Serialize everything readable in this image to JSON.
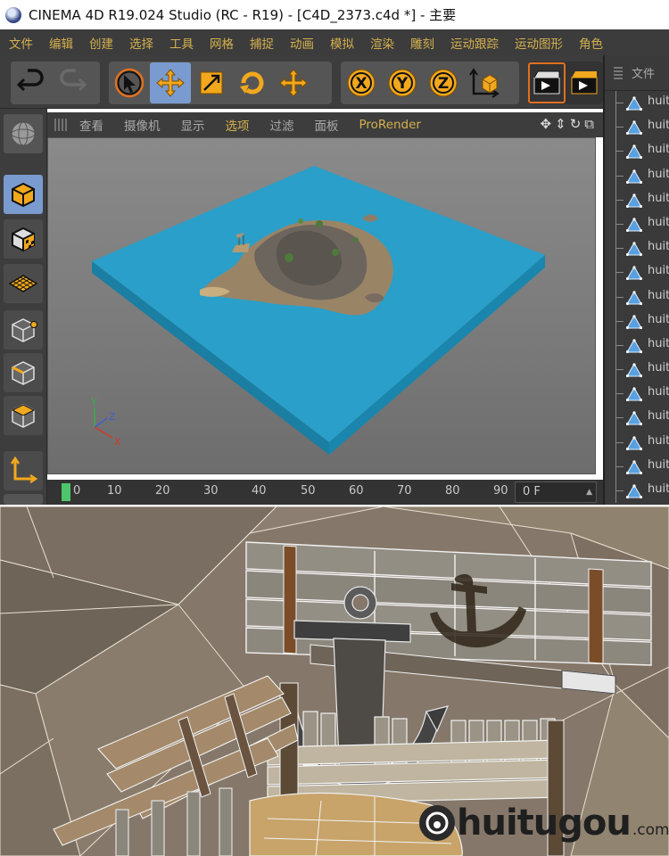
{
  "window": {
    "title": "CINEMA 4D R19.024 Studio (RC - R19) - [C4D_2373.c4d *] - 主要"
  },
  "menubar": {
    "items": [
      "文件",
      "编辑",
      "创建",
      "选择",
      "工具",
      "网格",
      "捕捉",
      "动画",
      "模拟",
      "渲染",
      "雕刻",
      "运动跟踪",
      "运动图形",
      "角色"
    ]
  },
  "toolbar": {
    "tools": [
      "undo-icon",
      "redo-icon",
      "select-icon",
      "move-icon",
      "scale-icon",
      "rotate-icon",
      "move-icon",
      "x-axis-icon",
      "y-axis-icon",
      "z-axis-icon",
      "world-coords-icon",
      "render-view-icon",
      "render-icon"
    ]
  },
  "viewport": {
    "menu": [
      "查看",
      "摄像机",
      "显示",
      "选项",
      "过滤",
      "面板",
      "ProRender"
    ],
    "highlighted_menu": "选项",
    "axis_labels": {
      "y": "Y",
      "z": "Z",
      "x": "X"
    }
  },
  "timeline": {
    "ticks": [
      "0",
      "10",
      "20",
      "30",
      "40",
      "50",
      "60",
      "70",
      "80",
      "90"
    ],
    "current_frame": "0 F"
  },
  "object_manager": {
    "header": "文件",
    "items": [
      "huit",
      "huit",
      "huit",
      "huit",
      "huit",
      "huit",
      "huit",
      "huit",
      "huit",
      "huit",
      "huit",
      "huit",
      "huit",
      "huit",
      "huit",
      "huit",
      "huit"
    ]
  },
  "watermark": {
    "brand": "huitugou",
    "domain": ".com"
  },
  "colors": {
    "menu_text": "#d4b04e",
    "active_tool": "#7a9bcf",
    "water": "#2a9fc9",
    "timeline_marker": "#4ec56b"
  }
}
